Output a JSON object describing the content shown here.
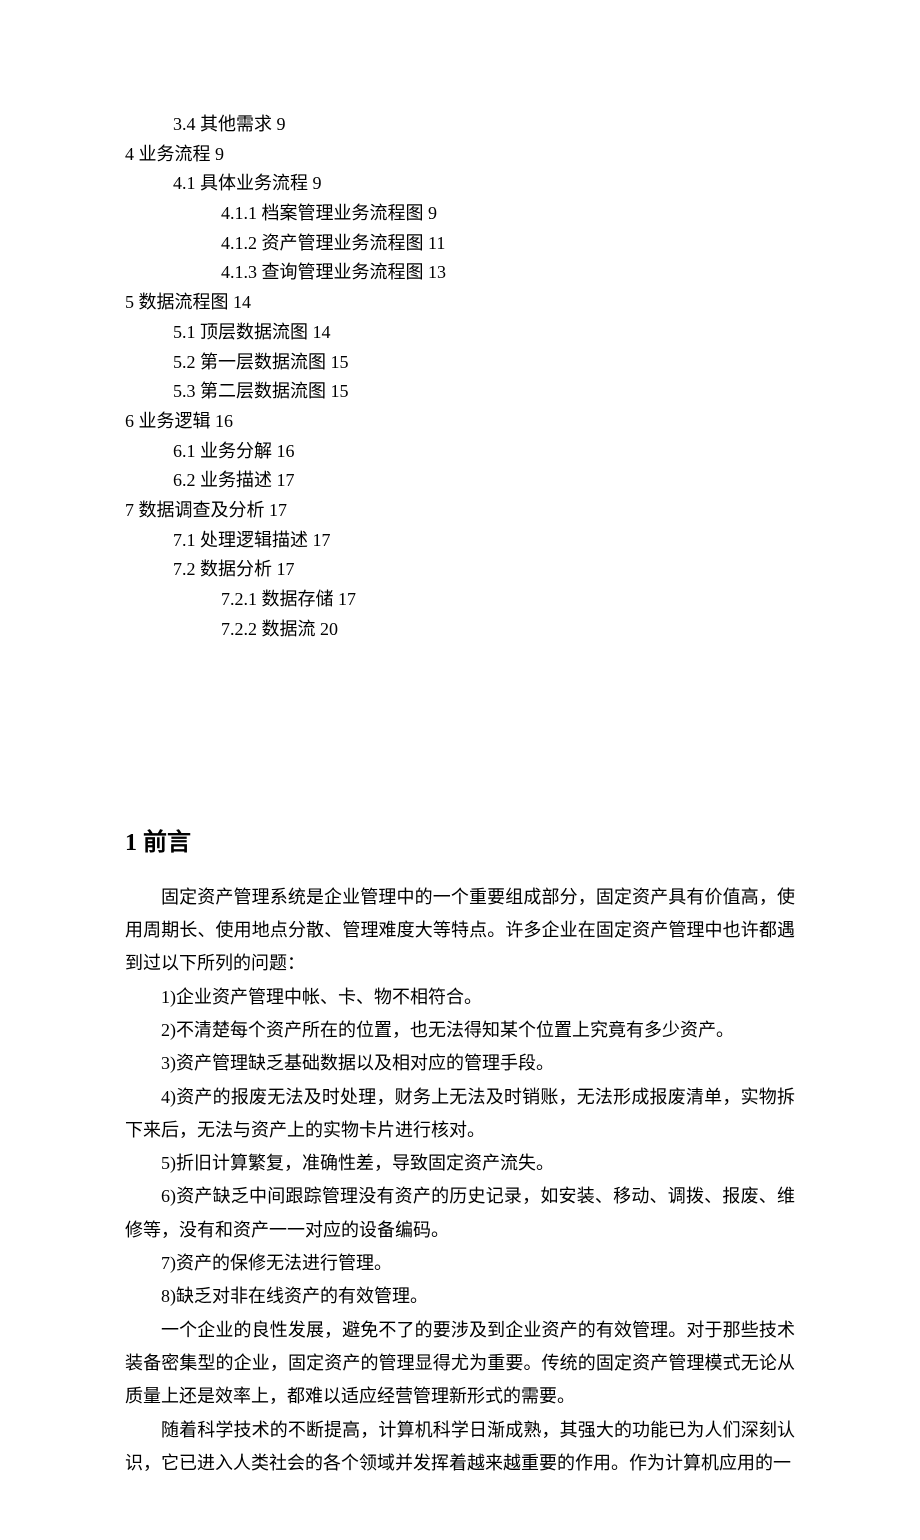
{
  "toc": [
    {
      "indent": 1,
      "text": "3.4 其他需求 9"
    },
    {
      "indent": 0,
      "text": "4 业务流程 9"
    },
    {
      "indent": 1,
      "text": "4.1 具体业务流程 9"
    },
    {
      "indent": 2,
      "text": "4.1.1 档案管理业务流程图 9"
    },
    {
      "indent": 2,
      "text": "4.1.2 资产管理业务流程图 11"
    },
    {
      "indent": 2,
      "text": "4.1.3 查询管理业务流程图 13"
    },
    {
      "indent": 0,
      "text": "5 数据流程图 14"
    },
    {
      "indent": 1,
      "text": "5.1 顶层数据流图 14"
    },
    {
      "indent": 1,
      "text": "5.2 第一层数据流图 15"
    },
    {
      "indent": 1,
      "text": "5.3 第二层数据流图 15"
    },
    {
      "indent": 0,
      "text": "6 业务逻辑 16"
    },
    {
      "indent": 1,
      "text": "6.1 业务分解 16"
    },
    {
      "indent": 1,
      "text": "6.2 业务描述 17"
    },
    {
      "indent": 0,
      "text": "7 数据调查及分析 17"
    },
    {
      "indent": 1,
      "text": "7.1 处理逻辑描述 17"
    },
    {
      "indent": 1,
      "text": "7.2 数据分析 17"
    },
    {
      "indent": 2,
      "text": "7.2.1 数据存储 17"
    },
    {
      "indent": 2,
      "text": "7.2.2 数据流 20"
    }
  ],
  "heading": "1 前言",
  "paragraphs": {
    "p1": "固定资产管理系统是企业管理中的一个重要组成部分，固定资产具有价值高，使用周期长、使用地点分散、管理难度大等特点。许多企业在固定资产管理中也许都遇到过以下所列的问题：",
    "i1": "1)企业资产管理中帐、卡、物不相符合。",
    "i2": "2)不清楚每个资产所在的位置，也无法得知某个位置上究竟有多少资产。",
    "i3": "3)资产管理缺乏基础数据以及相对应的管理手段。",
    "i4": "4)资产的报废无法及时处理，财务上无法及时销账，无法形成报废清单，实物拆下来后，无法与资产上的实物卡片进行核对。",
    "i5": "5)折旧计算繁复，准确性差，导致固定资产流失。",
    "i6": "6)资产缺乏中间跟踪管理没有资产的历史记录，如安装、移动、调拨、报废、维修等，没有和资产一一对应的设备编码。",
    "i7": "7)资产的保修无法进行管理。",
    "i8": "8)缺乏对非在线资产的有效管理。",
    "p2": "一个企业的良性发展，避免不了的要涉及到企业资产的有效管理。对于那些技术装备密集型的企业，固定资产的管理显得尤为重要。传统的固定资产管理模式无论从质量上还是效率上，都难以适应经营管理新形式的需要。",
    "p3": "随着科学技术的不断提高，计算机科学日渐成熟，其强大的功能已为人们深刻认识，它已进入人类社会的各个领域并发挥着越来越重要的作用。作为计算机应用的一"
  }
}
